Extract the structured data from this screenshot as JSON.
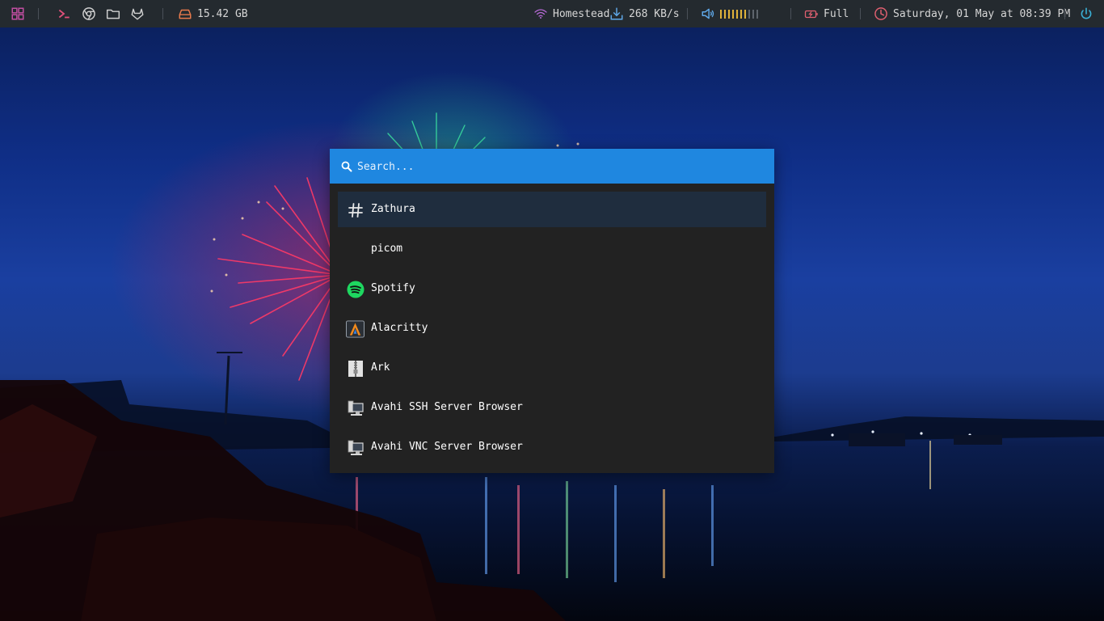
{
  "colors": {
    "bar_bg": "#242a2f",
    "search_bg": "#1f87e0",
    "launcher_bg": "#222222",
    "selected_row": "#1f2d3e",
    "accent_pink": "#d66a9e",
    "volume_on": "#e0b23a",
    "battery_red": "#e06070",
    "clock_red": "#e06070",
    "power_cyan": "#3ab0d6"
  },
  "topbar": {
    "disk": {
      "icon": "hard-drive-icon",
      "value": "15.42 GB"
    },
    "wifi": {
      "icon": "wifi-icon",
      "label": "Homestead"
    },
    "network": {
      "icon": "download-icon",
      "speed": "268 KB/s"
    },
    "volume": {
      "icon": "speaker-icon",
      "level": 0.7
    },
    "battery": {
      "icon": "battery-charging-icon",
      "label": "Full"
    },
    "clock": {
      "icon": "clock-icon",
      "datetime": "Saturday, 01 May at 08:39 PM"
    },
    "power": {
      "icon": "power-icon"
    }
  },
  "launcher": {
    "search_placeholder": "Search...",
    "search_value": "",
    "items": [
      {
        "label": "Zathura",
        "icon": "hash-icon",
        "selected": true
      },
      {
        "label": "picom",
        "icon": "",
        "selected": false
      },
      {
        "label": "Spotify",
        "icon": "spotify-icon",
        "selected": false
      },
      {
        "label": "Alacritty",
        "icon": "alacritty-icon",
        "selected": false
      },
      {
        "label": "Ark",
        "icon": "archive-icon",
        "selected": false
      },
      {
        "label": "Avahi SSH Server Browser",
        "icon": "network-computer-icon",
        "selected": false
      },
      {
        "label": "Avahi VNC Server Browser",
        "icon": "network-computer-icon",
        "selected": false
      }
    ]
  }
}
